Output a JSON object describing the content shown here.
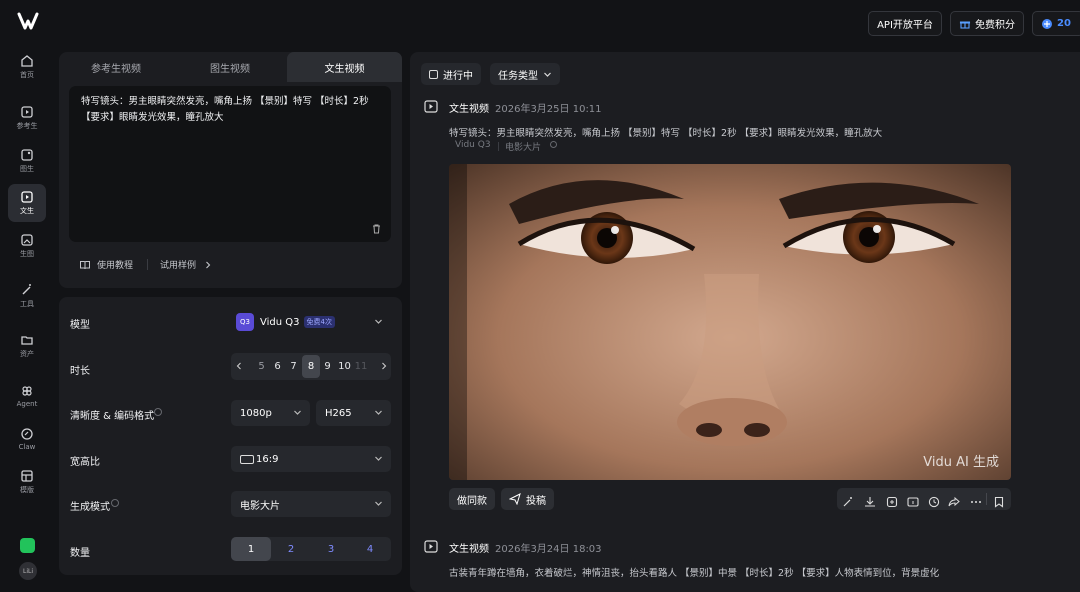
{
  "app": {
    "name": "Vidu"
  },
  "sidebar": {
    "items": [
      {
        "label": "首页",
        "icon": "home-icon"
      },
      {
        "label": "参考生",
        "icon": "reference-icon"
      },
      {
        "label": "图生",
        "icon": "image-icon"
      },
      {
        "label": "文生",
        "icon": "text-video-icon",
        "active": true
      },
      {
        "label": "生图",
        "icon": "generate-image-icon"
      },
      {
        "label": "工具",
        "icon": "wand-icon"
      },
      {
        "label": "资产",
        "icon": "folder-icon"
      },
      {
        "label": "Agent",
        "icon": "agent-icon"
      },
      {
        "label": "Claw",
        "icon": "claw-icon"
      },
      {
        "label": "模版",
        "icon": "template-icon"
      }
    ],
    "user": "LiLi"
  },
  "header": {
    "api_label": "API开放平台",
    "points_label": "免费积分",
    "credits": "20"
  },
  "tabs": [
    {
      "label": "参考生视频"
    },
    {
      "label": "图生视频"
    },
    {
      "label": "文生视频",
      "active": true
    }
  ],
  "prompt": {
    "text": "特写镜头：男主眼睛突然发亮，嘴角上扬 【景别】特写 【时长】2秒 【要求】眼睛发光效果，瞳孔放大",
    "tutorial_label": "使用教程",
    "examples_label": "试用样例"
  },
  "settings": {
    "model_label": "模型",
    "model_value": "Vidu Q3",
    "model_badge": "免费4次",
    "duration_label": "时长",
    "duration_options": [
      "5",
      "6",
      "7",
      "8",
      "9",
      "10",
      "11"
    ],
    "duration_selected": "8",
    "resolution_label": "清晰度 & 编码格式",
    "resolution_value": "1080p",
    "codec_value": "H265",
    "ratio_label": "宽高比",
    "ratio_value": "16:9",
    "mode_label": "生成模式",
    "mode_value": "电影大片",
    "count_label": "数量",
    "count_options": [
      "1",
      "2",
      "3",
      "4"
    ],
    "count_selected": "1"
  },
  "feed": {
    "filter_in_progress": "进行中",
    "filter_task_type": "任务类型",
    "tasks": [
      {
        "type": "文生视频",
        "time": "2026年3月25日 10:11",
        "prompt": "特写镜头：男主眼睛突然发亮，嘴角上扬 【景别】特写 【时长】2秒 【要求】眼睛发光效果，瞳孔放大",
        "model": "Vidu Q3",
        "mode": "电影大片",
        "watermark": "Vidu AI 生成",
        "same_label": "做同款",
        "submit_label": "投稿"
      },
      {
        "type": "文生视频",
        "time": "2026年3月24日 18:03",
        "prompt": "古装青年蹲在墙角，衣着破烂，神情沮丧，抬头看路人 【景别】中景 【时长】2秒 【要求】人物表情到位，背景虚化"
      }
    ]
  },
  "colors": {
    "accent": "#7f8bff",
    "background": "#121316",
    "panel": "#1c1d21"
  }
}
